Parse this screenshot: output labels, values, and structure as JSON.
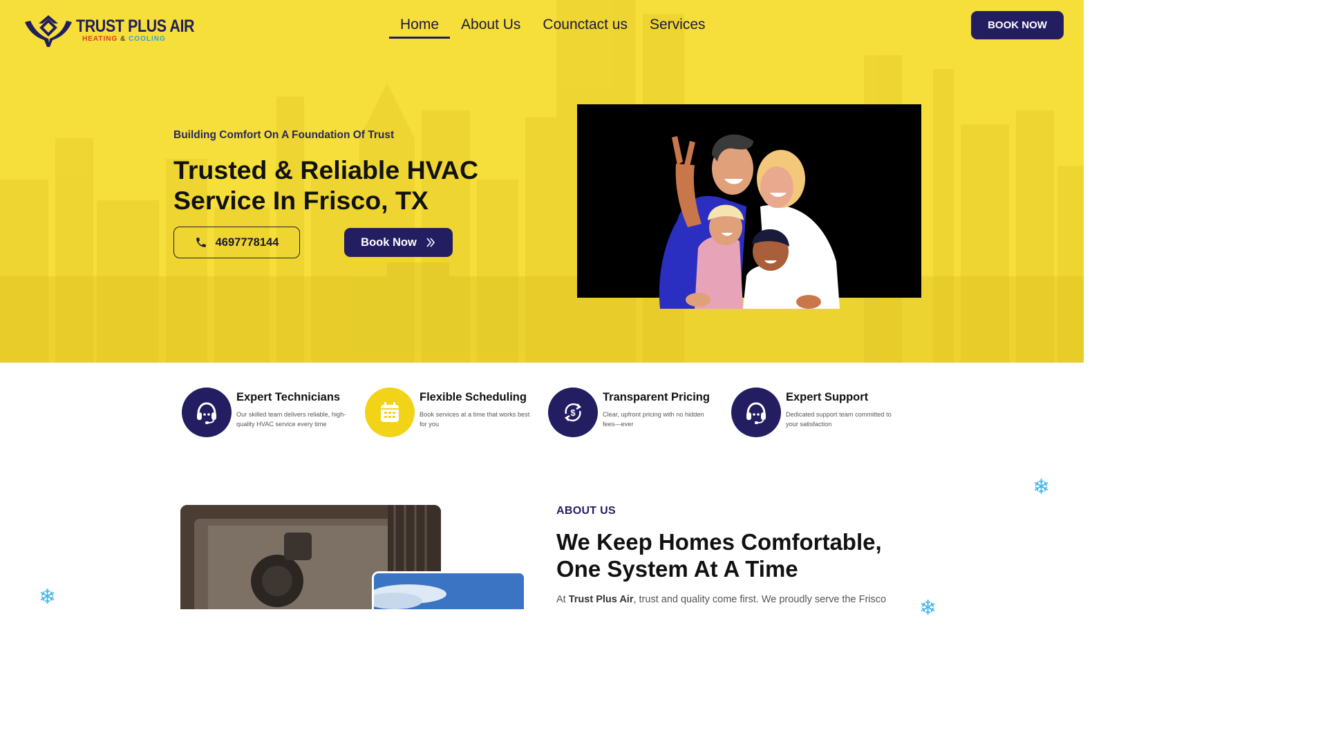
{
  "brand": {
    "name": "TRUST PLUS AIR",
    "sub_heating": "HEATING",
    "sub_amp": "&",
    "sub_cooling": "COOLING"
  },
  "nav": {
    "items": [
      {
        "label": "Home",
        "active": true
      },
      {
        "label": "About Us",
        "active": false
      },
      {
        "label": "Counctact us",
        "active": false
      },
      {
        "label": "Services",
        "active": false
      }
    ],
    "book_label": "BOOK NOW"
  },
  "hero": {
    "tagline": "Building Comfort On A Foundation Of Trust",
    "headline": "Trusted & Reliable HVAC Service In Frisco, TX",
    "phone": "4697778144",
    "book_label": "Book Now"
  },
  "features": [
    {
      "title": "Expert Technicians",
      "desc": "Our skilled team delivers reliable, high-quality HVAC service every time",
      "icon": "headset-icon",
      "color": "navy"
    },
    {
      "title": "Flexible Scheduling",
      "desc": "Book services at a time that works best for you",
      "icon": "calendar-icon",
      "color": "yellow"
    },
    {
      "title": "Transparent Pricing",
      "desc": "Clear, upfront pricing with no hidden fees—ever",
      "icon": "dollar-cycle-icon",
      "color": "navy"
    },
    {
      "title": "Expert Support",
      "desc": "Dedicated support team committed to your satisfaction",
      "icon": "headset-icon",
      "color": "navy"
    }
  ],
  "about": {
    "label": "ABOUT US",
    "title": "We Keep Homes Comfortable, One System At A Time",
    "text_prefix": "At ",
    "text_brand": "Trust Plus Air",
    "text_suffix": ", trust and quality come first. We proudly serve the Frisco"
  },
  "colors": {
    "primary": "#231d62",
    "accent": "#f6df3a",
    "snow": "#41b5ea"
  }
}
